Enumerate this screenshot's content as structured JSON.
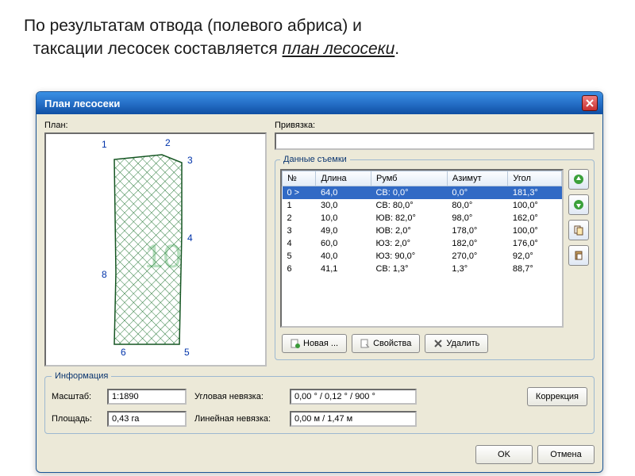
{
  "slide_text_a": "По результатам отвода (полевого абриса) и",
  "slide_text_b": "таксации лесосек составляется ",
  "slide_text_em": "план лесосеки",
  "slide_text_dot": ".",
  "window": {
    "title": "План лесосеки"
  },
  "labels": {
    "plan": "План:",
    "binding": "Привязка:",
    "survey": "Данные съемки",
    "info": "Информация",
    "scale": "Масштаб:",
    "area": "Площадь:",
    "ang_err": "Угловая невязка:",
    "lin_err": "Линейная невязка:"
  },
  "binding_value": "",
  "table": {
    "headers": {
      "n": "№",
      "len": "Длина",
      "rumb": "Румб",
      "az": "Азимут",
      "ang": "Угол"
    },
    "rows": [
      {
        "n": "0   >",
        "len": "64,0",
        "rumb": "СВ: 0,0°",
        "az": "0,0°",
        "ang": "181,3°",
        "sel": true
      },
      {
        "n": "1",
        "len": "30,0",
        "rumb": "СВ: 80,0°",
        "az": "80,0°",
        "ang": "100,0°",
        "sel": false
      },
      {
        "n": "2",
        "len": "10,0",
        "rumb": "ЮВ: 82,0°",
        "az": "98,0°",
        "ang": "162,0°",
        "sel": false
      },
      {
        "n": "3",
        "len": "49,0",
        "rumb": "ЮВ: 2,0°",
        "az": "178,0°",
        "ang": "100,0°",
        "sel": false
      },
      {
        "n": "4",
        "len": "60,0",
        "rumb": "ЮЗ: 2,0°",
        "az": "182,0°",
        "ang": "176,0°",
        "sel": false
      },
      {
        "n": "5",
        "len": "40,0",
        "rumb": "ЮЗ: 90,0°",
        "az": "270,0°",
        "ang": "92,0°",
        "sel": false
      },
      {
        "n": "6",
        "len": "41,1",
        "rumb": "СВ: 1,3°",
        "az": "1,3°",
        "ang": "88,7°",
        "sel": false
      }
    ]
  },
  "buttons": {
    "new": "Новая ...",
    "props": "Свойства",
    "delete": "Удалить",
    "correction": "Коррекция",
    "ok": "OK",
    "cancel": "Отмена"
  },
  "info": {
    "scale": "1:1890",
    "area": "0,43 га",
    "ang_err": "0,00 ° / 0,12 ° / 900 °",
    "lin_err": "0,00 м / 1,47 м"
  },
  "plan_labels": {
    "big": "10",
    "v1": "1",
    "v2": "2",
    "v3": "3",
    "v4": "4",
    "v5": "5",
    "v6": "6",
    "v8": "8"
  }
}
